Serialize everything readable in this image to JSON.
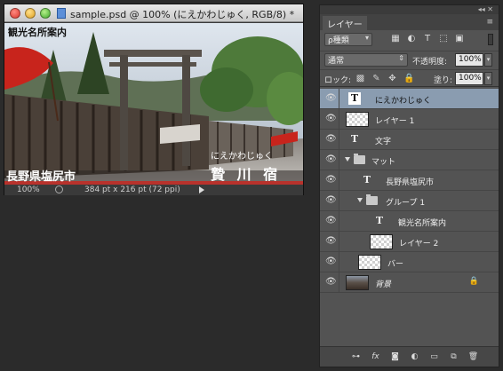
{
  "document": {
    "title": "sample.psd @ 100% (にえかわじゅく, RGB/8) *",
    "canvas_texts": {
      "top_label": "観光名所案内",
      "kana": "にえかわじゅく",
      "place": "贄 川 宿",
      "city": "長野県塩尻市"
    },
    "status": {
      "zoom": "100%",
      "info": "384 pt x 216 pt (72 ppi)"
    }
  },
  "layers_panel": {
    "top_controls": "◂◂ ✕",
    "tab_label": "レイヤー",
    "menu_icon": "≡",
    "filter": {
      "kind_label": "ρ種類",
      "icons": [
        "pixel-filter-icon",
        "adjustment-filter-icon",
        "type-filter-icon",
        "shape-filter-icon",
        "smart-object-filter-icon"
      ]
    },
    "blend_mode": "通常",
    "opacity_label": "不透明度:",
    "opacity_value": "100%",
    "lock_label": "ロック:",
    "fill_label": "塗り:",
    "fill_value": "100%",
    "layers": [
      {
        "name": "にえかわじゅく",
        "kind": "text",
        "selected": true
      },
      {
        "name": "レイヤー 1",
        "kind": "pixel"
      },
      {
        "name": "文字",
        "kind": "text"
      },
      {
        "name": "マット",
        "kind": "group"
      },
      {
        "name": "長野県塩尻市",
        "kind": "text"
      },
      {
        "name": "グループ 1",
        "kind": "group"
      },
      {
        "name": "観光名所案内",
        "kind": "text"
      },
      {
        "name": "レイヤー 2",
        "kind": "pixel"
      },
      {
        "name": "バー",
        "kind": "pixel"
      },
      {
        "name": "背景",
        "kind": "background",
        "locked": true
      }
    ]
  },
  "colors": {
    "panel_bg": "#535353",
    "selected_row": "#8a9cb0",
    "app_bg": "#2b2b2b"
  }
}
